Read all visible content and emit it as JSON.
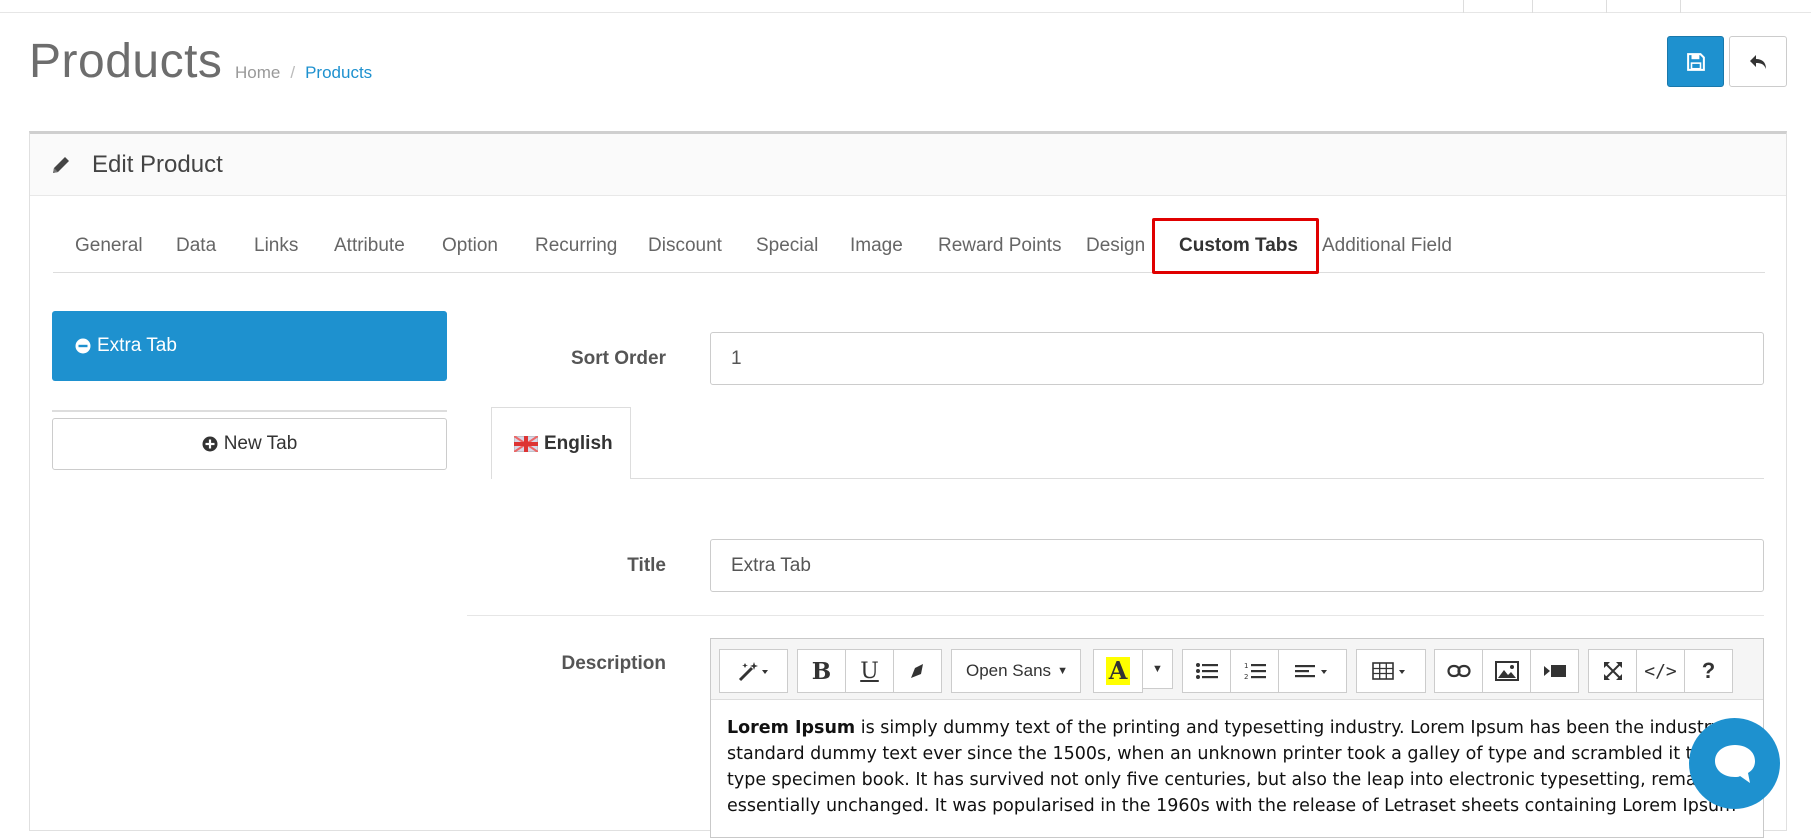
{
  "page": {
    "title": "Products",
    "breadcrumb": [
      "Home",
      "Products"
    ],
    "breadcrumb_separator": "/"
  },
  "panel": {
    "heading": "Edit Product"
  },
  "tabs": [
    {
      "label": "General"
    },
    {
      "label": "Data"
    },
    {
      "label": "Links"
    },
    {
      "label": "Attribute"
    },
    {
      "label": "Option"
    },
    {
      "label": "Recurring"
    },
    {
      "label": "Discount"
    },
    {
      "label": "Special"
    },
    {
      "label": "Image"
    },
    {
      "label": "Reward Points"
    },
    {
      "label": "Design"
    },
    {
      "label": "Custom Tabs",
      "active": true,
      "highlighted": true
    },
    {
      "label": "Additional Field"
    }
  ],
  "custom_tabs": {
    "items": [
      {
        "label": "Extra Tab"
      }
    ],
    "new_tab_label": "New Tab"
  },
  "form": {
    "sort_order_label": "Sort Order",
    "sort_order_value": "1",
    "language_tab": "English",
    "title_label": "Title",
    "title_value": "Extra Tab",
    "description_label": "Description",
    "font_select": "Open Sans",
    "description_bold": "Lorem Ipsum",
    "description_lines": [
      " is simply dummy text of the printing and typesetting industry. Lorem Ipsum has been the industry's",
      "standard dummy text ever since the 1500s, when an unknown printer took a galley of type and scrambled it to mak",
      "type specimen book. It has survived not only five centuries, but also the leap into electronic typesetting, remaining",
      "essentially unchanged. It was popularised in the 1960s with the release of Letraset sheets containing Lorem Ipsum"
    ]
  },
  "colors": {
    "primary": "#1e91cf",
    "highlight_border": "#e00000",
    "highlight_yellow": "#ffff00"
  }
}
